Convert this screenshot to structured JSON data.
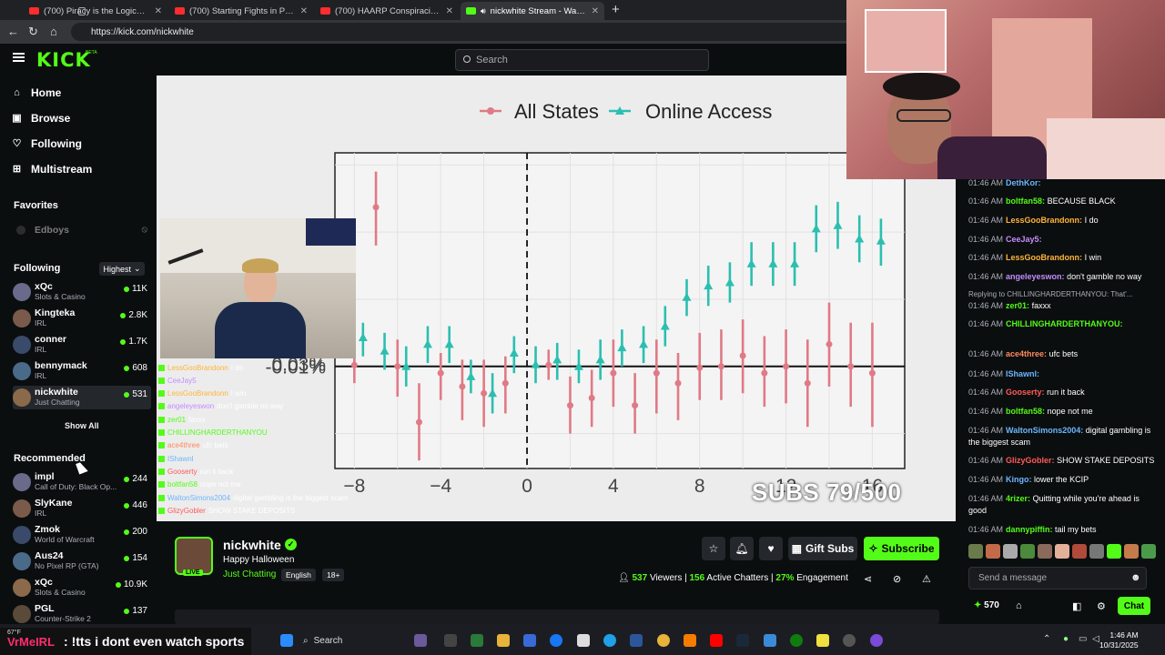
{
  "browser": {
    "tabs": [
      {
        "title": "(700) Piracy is the Logical Solutio",
        "icon": "youtube-icon"
      },
      {
        "title": "(700) Starting Fights in Public Pra",
        "icon": "youtube-icon"
      },
      {
        "title": "(700) HAARP Conspiracies: Was T",
        "icon": "youtube-icon"
      },
      {
        "title": "nickwhite Stream - Watch Li",
        "icon": "kick-icon"
      }
    ],
    "url": "https://kick.com/nickwhite"
  },
  "header": {
    "logo": "KICK",
    "beta": "BETA",
    "search_placeholder": "Search"
  },
  "sidebar": {
    "nav": [
      {
        "label": "Home",
        "icon": "home-icon"
      },
      {
        "label": "Browse",
        "icon": "browse-icon"
      },
      {
        "label": "Following",
        "icon": "heart-icon"
      },
      {
        "label": "Multistream",
        "icon": "grid-icon"
      }
    ],
    "favorites_title": "Favorites",
    "favorites": [
      {
        "name": "Edboys"
      }
    ],
    "following_title": "Following",
    "sort_label": "Highest",
    "following": [
      {
        "name": "xQc",
        "category": "Slots & Casino",
        "viewers": "11K"
      },
      {
        "name": "Kingteka",
        "category": "IRL",
        "viewers": "2.8K"
      },
      {
        "name": "conner",
        "category": "IRL",
        "viewers": "1.7K"
      },
      {
        "name": "bennymack",
        "category": "IRL",
        "viewers": "608"
      },
      {
        "name": "nickwhite",
        "category": "Just Chatting",
        "viewers": "531"
      }
    ],
    "show_all": "Show All",
    "recommended_title": "Recommended",
    "recommended": [
      {
        "name": "impl",
        "category": "Call of Duty: Black Op...",
        "viewers": "244"
      },
      {
        "name": "SlyKane",
        "category": "IRL",
        "viewers": "446"
      },
      {
        "name": "Zmok",
        "category": "World of Warcraft",
        "viewers": "200"
      },
      {
        "name": "Aus24",
        "category": "No Pixel RP (GTA)",
        "viewers": "154"
      },
      {
        "name": "xQc",
        "category": "Slots & Casino",
        "viewers": "10.9K"
      },
      {
        "name": "PGL",
        "category": "Counter-Strike 2",
        "viewers": "137"
      }
    ]
  },
  "video": {
    "subs_goal": "SUBS 79/500",
    "overlay_chat": [
      {
        "user": "LessGooBrandonn",
        "msg": "I do",
        "color": "#ffb43a"
      },
      {
        "user": "CeeJay5",
        "msg": "",
        "color": "#c58cff"
      },
      {
        "user": "LessGooBrandonn",
        "msg": "I win",
        "color": "#ffb43a"
      },
      {
        "user": "angeleyeswon",
        "msg": "don't gamble no way",
        "color": "#c58cff"
      },
      {
        "user": "zer01",
        "msg": "faxxx",
        "color": "#53fc18"
      },
      {
        "user": "CHILLINGHARDERTHANYOU",
        "msg": "",
        "color": "#53fc18"
      },
      {
        "user": "ace4three",
        "msg": "ufc bets",
        "color": "#ff8a5c"
      },
      {
        "user": "IShawnl",
        "msg": "",
        "color": "#6cb6ff"
      },
      {
        "user": "Gooserty",
        "msg": "run it back",
        "color": "#ff5a5a"
      },
      {
        "user": "boltfan58",
        "msg": "nope not me",
        "color": "#53fc18"
      },
      {
        "user": "WaltonSimons2004",
        "msg": "digital gambling is the biggest scam",
        "color": "#6cb6ff"
      },
      {
        "user": "GlizyGobler",
        "msg": "SHOW STAKE DEPOSITS",
        "color": "#ff5a5a"
      }
    ]
  },
  "chart_data": {
    "type": "scatter",
    "legend": [
      "All States",
      "Online Access"
    ],
    "legend_position": "top",
    "colors": {
      "All States": "#e07a86",
      "Online Access": "#2bbfb0"
    },
    "y_ticks": [
      "0.03%",
      "-0.01%"
    ],
    "x_ticks": [
      -8,
      -4,
      0,
      4,
      8,
      12,
      16
    ],
    "xlim": [
      -8.9,
      17.5
    ],
    "ylim": [
      -0.0152,
      0.0318
    ],
    "series": [
      {
        "name": "All States",
        "points": [
          {
            "x": -8,
            "y": 0.0002,
            "lo": -0.0025,
            "hi": 0.0025
          },
          {
            "x": -7,
            "y": 0.0237,
            "lo": 0.018,
            "hi": 0.029
          },
          {
            "x": -6,
            "y": 0.0,
            "lo": -0.0045,
            "hi": 0.004
          },
          {
            "x": -5,
            "y": -0.0083,
            "lo": -0.014,
            "hi": -0.0025
          },
          {
            "x": -4,
            "y": -0.001,
            "lo": -0.005,
            "hi": 0.002
          },
          {
            "x": -3,
            "y": -0.003,
            "lo": -0.008,
            "hi": 0.001
          },
          {
            "x": -2,
            "y": -0.004,
            "lo": -0.009,
            "hi": 0.001
          },
          {
            "x": -1,
            "y": -0.0025,
            "lo": -0.007,
            "hi": 0.0015
          },
          {
            "x": 1,
            "y": 0.0002,
            "lo": -0.002,
            "hi": 0.0025
          },
          {
            "x": 2,
            "y": -0.0058,
            "lo": -0.01,
            "hi": -0.0015
          },
          {
            "x": 3,
            "y": -0.0047,
            "lo": -0.009,
            "hi": -0.0005
          },
          {
            "x": 4,
            "y": -0.001,
            "lo": -0.006,
            "hi": 0.004
          },
          {
            "x": 5,
            "y": -0.0058,
            "lo": -0.01,
            "hi": -0.001
          },
          {
            "x": 6,
            "y": -0.001,
            "lo": -0.007,
            "hi": 0.004
          },
          {
            "x": 7,
            "y": -0.0025,
            "lo": -0.008,
            "hi": 0.002
          },
          {
            "x": 8,
            "y": -0.0002,
            "lo": -0.005,
            "hi": 0.005
          },
          {
            "x": 9,
            "y": 0.0,
            "lo": -0.005,
            "hi": 0.0055
          },
          {
            "x": 10,
            "y": 0.0016,
            "lo": -0.004,
            "hi": 0.007
          },
          {
            "x": 11,
            "y": -0.001,
            "lo": -0.006,
            "hi": 0.0045
          },
          {
            "x": 12,
            "y": 0.0,
            "lo": -0.0055,
            "hi": 0.0055
          },
          {
            "x": 13,
            "y": -0.0025,
            "lo": -0.009,
            "hi": 0.004
          },
          {
            "x": 14,
            "y": 0.0033,
            "lo": -0.003,
            "hi": 0.0095
          },
          {
            "x": 15,
            "y": 0.0,
            "lo": -0.006,
            "hi": 0.0065
          },
          {
            "x": 16,
            "y": -0.001,
            "lo": -0.009,
            "hi": 0.0065
          }
        ]
      },
      {
        "name": "Online Access",
        "points": [
          {
            "x": -7.6,
            "y": 0.0043,
            "lo": 0.0015,
            "hi": 0.0065
          },
          {
            "x": -6.6,
            "y": 0.0023,
            "lo": -0.0005,
            "hi": 0.005
          },
          {
            "x": -5.6,
            "y": 0.0,
            "lo": -0.003,
            "hi": 0.003
          },
          {
            "x": -4.6,
            "y": 0.0033,
            "lo": 0.0005,
            "hi": 0.006
          },
          {
            "x": -3.6,
            "y": 0.0033,
            "lo": 0.0005,
            "hi": 0.006
          },
          {
            "x": -2.6,
            "y": -0.0015,
            "lo": -0.004,
            "hi": 0.001
          },
          {
            "x": -1.6,
            "y": -0.004,
            "lo": -0.007,
            "hi": -0.001
          },
          {
            "x": -0.6,
            "y": 0.002,
            "lo": -0.001,
            "hi": 0.0045
          },
          {
            "x": 0.4,
            "y": 0.0003,
            "lo": -0.0025,
            "hi": 0.003
          },
          {
            "x": 1.4,
            "y": 0.001,
            "lo": -0.002,
            "hi": 0.0035
          },
          {
            "x": 2.4,
            "y": 0.0,
            "lo": -0.0025,
            "hi": 0.0025
          },
          {
            "x": 3.4,
            "y": 0.001,
            "lo": -0.002,
            "hi": 0.004
          },
          {
            "x": 4.4,
            "y": 0.0028,
            "lo": 0.0,
            "hi": 0.0055
          },
          {
            "x": 5.4,
            "y": 0.0033,
            "lo": 0.0005,
            "hi": 0.006
          },
          {
            "x": 6.4,
            "y": 0.006,
            "lo": 0.003,
            "hi": 0.009
          },
          {
            "x": 7.4,
            "y": 0.0103,
            "lo": 0.0075,
            "hi": 0.013
          },
          {
            "x": 8.4,
            "y": 0.012,
            "lo": 0.009,
            "hi": 0.015
          },
          {
            "x": 9.4,
            "y": 0.0125,
            "lo": 0.0095,
            "hi": 0.0155
          },
          {
            "x": 10.4,
            "y": 0.0153,
            "lo": 0.012,
            "hi": 0.0185
          },
          {
            "x": 11.4,
            "y": 0.0153,
            "lo": 0.012,
            "hi": 0.0185
          },
          {
            "x": 12.4,
            "y": 0.0153,
            "lo": 0.012,
            "hi": 0.0185
          },
          {
            "x": 13.4,
            "y": 0.0205,
            "lo": 0.017,
            "hi": 0.024
          },
          {
            "x": 14.4,
            "y": 0.021,
            "lo": 0.0175,
            "hi": 0.0245
          },
          {
            "x": 15.4,
            "y": 0.019,
            "lo": 0.0155,
            "hi": 0.0225
          },
          {
            "x": 16.4,
            "y": 0.0187,
            "lo": 0.015,
            "hi": 0.022
          }
        ]
      }
    ]
  },
  "channel": {
    "name": "nickwhite",
    "live_badge": "LIVE",
    "title": "Happy Halloween",
    "category": "Just Chatting",
    "tags": [
      "English",
      "18+"
    ],
    "gift_label": "Gift Subs",
    "subscribe_label": "Subscribe",
    "viewers": "537",
    "viewers_label": "Viewers",
    "chatters": "156",
    "chatters_label": "Active Chatters",
    "engagement": "27%",
    "engagement_label": "Engagement"
  },
  "chat": {
    "messages": [
      {
        "time": "01:46 AM",
        "user": "DethKor:",
        "msg": "",
        "color": "#6cb6ff"
      },
      {
        "time": "01:46 AM",
        "user": "boltfan58:",
        "msg": "BECAUSE BLACK",
        "color": "#53fc18"
      },
      {
        "time": "01:46 AM",
        "user": "LessGooBrandonn:",
        "msg": "I do",
        "color": "#ffb43a"
      },
      {
        "time": "01:46 AM",
        "user": "CeeJay5:",
        "msg": "",
        "color": "#c58cff"
      },
      {
        "time": "01:46 AM",
        "user": "LessGooBrandonn:",
        "msg": "I win",
        "color": "#ffb43a"
      },
      {
        "time": "01:46 AM",
        "user": "angeleyeswon:",
        "msg": "don't gamble no way",
        "color": "#c58cff"
      },
      {
        "time": "",
        "user": "",
        "msg": "Replying to CHILLINGHARDERTHANYOU: That'...",
        "color": "#adadb8"
      },
      {
        "time": "01:46 AM",
        "user": "zer01:",
        "msg": "faxxx",
        "color": "#53fc18"
      },
      {
        "time": "01:46 AM",
        "user": "CHILLINGHARDERTHANYOU:",
        "msg": "",
        "color": "#53fc18"
      },
      {
        "time": "01:46 AM",
        "user": "ace4three:",
        "msg": "ufc bets",
        "color": "#ff8a5c"
      },
      {
        "time": "01:46 AM",
        "user": "IShawnl:",
        "msg": "",
        "color": "#6cb6ff"
      },
      {
        "time": "01:46 AM",
        "user": "Gooserty:",
        "msg": "run it back",
        "color": "#ff5a5a"
      },
      {
        "time": "01:46 AM",
        "user": "boltfan58:",
        "msg": "nope not me",
        "color": "#53fc18"
      },
      {
        "time": "01:46 AM",
        "user": "WaltonSimons2004:",
        "msg": "digital gambling is the biggest scam",
        "color": "#6cb6ff"
      },
      {
        "time": "01:46 AM",
        "user": "GlizyGobler:",
        "msg": "SHOW STAKE DEPOSITS",
        "color": "#ff5a5a"
      },
      {
        "time": "01:46 AM",
        "user": "Kingo:",
        "msg": "lower the KCIP",
        "color": "#6cb6ff"
      },
      {
        "time": "01:46 AM",
        "user": "4rizer:",
        "msg": "Quitting while you're ahead is good",
        "color": "#53fc18"
      },
      {
        "time": "01:46 AM",
        "user": "dannypiffin:",
        "msg": "tail my bets",
        "color": "#53fc18"
      }
    ],
    "input_placeholder": "Send a message",
    "points": "570",
    "chat_button": "Chat"
  },
  "taskbar": {
    "marquee_user": "VrMeIRL",
    "marquee_text": ": !tts i dont even watch sports",
    "search": "Search",
    "temp": "67°F",
    "time": "1:46 AM",
    "date": "10/31/2025"
  }
}
